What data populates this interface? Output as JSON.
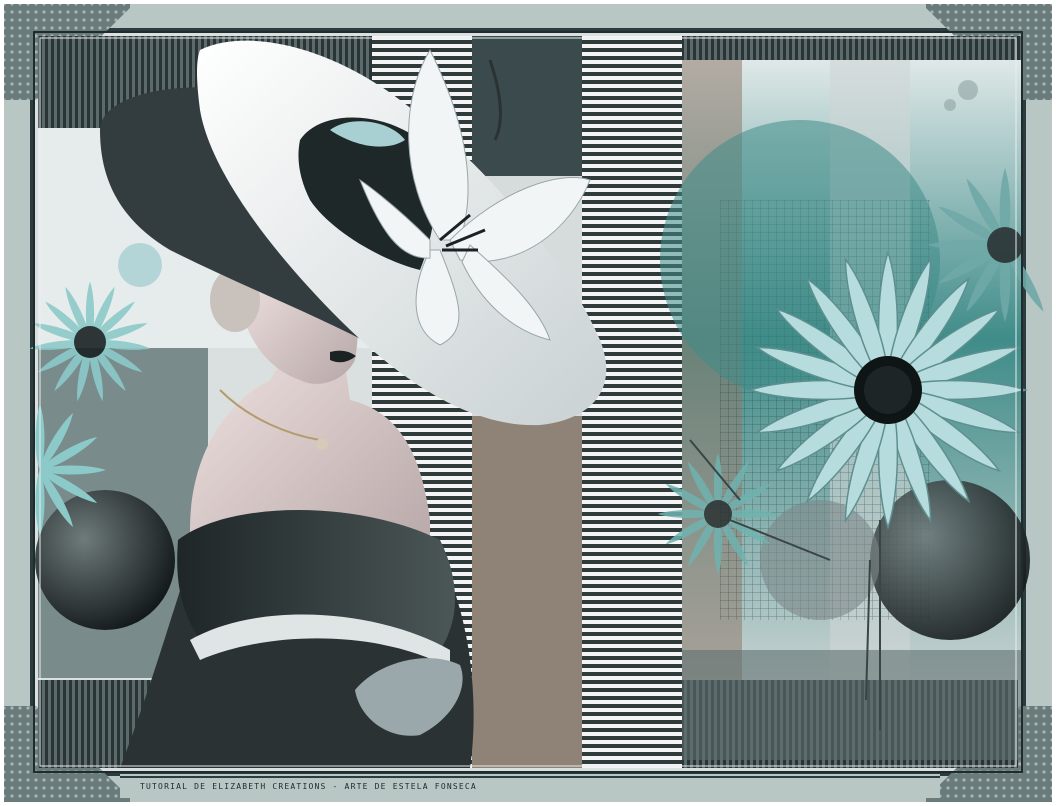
{
  "artwork": {
    "credit_text": "TUTORIAL DE ELIZABETH CREATIONS - ARTE DE ESTELA FONSECA",
    "subject": "woman-in-wide-brim-hat-with-lily",
    "palette": {
      "frame_outer": "#b8c6c4",
      "frame_dark": "#2b3c3e",
      "teal": "#3f8c89",
      "pale_teal": "#a8d0d2",
      "taupe": "#8f8378",
      "charcoal": "#2a3234",
      "hat_white": "#eef2f2"
    }
  }
}
